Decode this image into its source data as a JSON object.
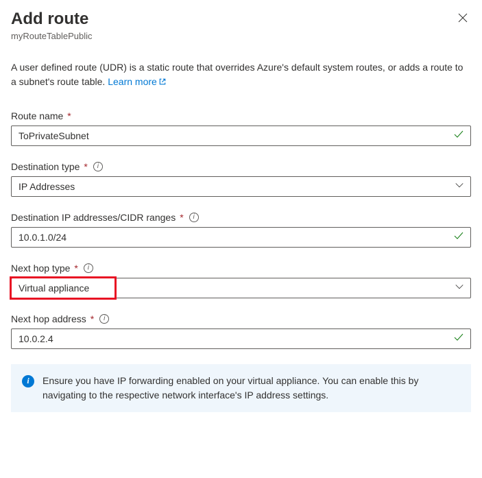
{
  "header": {
    "title": "Add route",
    "subtitle": "myRouteTablePublic"
  },
  "description": {
    "text": "A user defined route (UDR) is a static route that overrides Azure's default system routes, or adds a route to a subnet's route table. ",
    "link_text": "Learn more"
  },
  "fields": {
    "route_name": {
      "label": "Route name",
      "value": "ToPrivateSubnet"
    },
    "destination_type": {
      "label": "Destination type",
      "value": "IP Addresses"
    },
    "destination_cidr": {
      "label": "Destination IP addresses/CIDR ranges",
      "value": "10.0.1.0/24"
    },
    "next_hop_type": {
      "label": "Next hop type",
      "value": "Virtual appliance"
    },
    "next_hop_address": {
      "label": "Next hop address",
      "value": "10.0.2.4"
    }
  },
  "info_panel": {
    "text": "Ensure you have IP forwarding enabled on your virtual appliance. You can enable this by navigating to the respective network interface's IP address settings."
  }
}
